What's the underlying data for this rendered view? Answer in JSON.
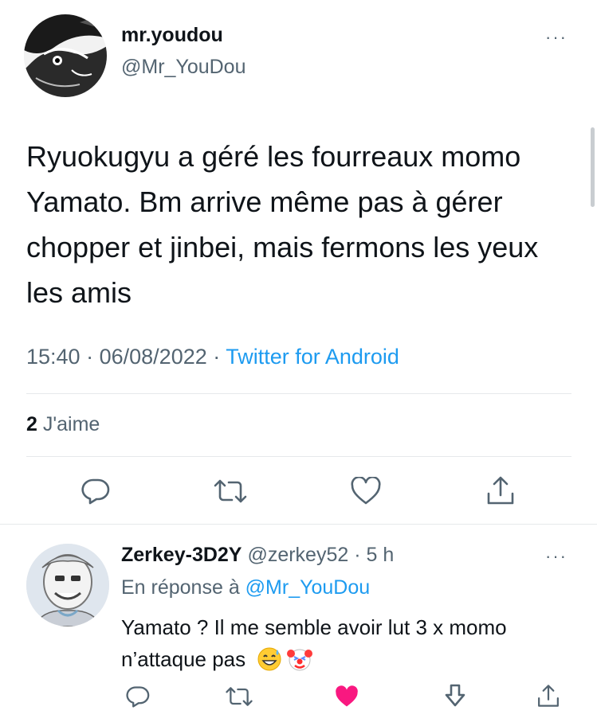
{
  "tweet": {
    "author_name": "mr.youdou",
    "author_handle": "@Mr_YouDou",
    "more_glyph": "···",
    "text": "Ryuokugyu a géré les fourreaux momo Yamato. Bm arrive même pas à gérer chopper et jinbei, mais fermons les yeux les amis",
    "time": "15:40",
    "date": "06/08/2022",
    "sep": "·",
    "source": "Twitter for Android",
    "likes_count": "2",
    "likes_label": "J'aime",
    "icons": [
      "reply-icon",
      "retweet-icon",
      "like-icon",
      "share-icon"
    ]
  },
  "reply": {
    "author_name": "Zerkey-3D2Y",
    "author_handle": "@zerkey52",
    "sep": "·",
    "age": "5 h",
    "more_glyph": "···",
    "in_reply_prefix": "En réponse à",
    "in_reply_handle": "@Mr_YouDou",
    "text_line1": "Yamato ? Il me semble avoir lut 3 x momo",
    "text_line2": "n’attaque pas",
    "emojis": [
      "sweat-smile-emoji",
      "clown-emoji"
    ],
    "liked": true,
    "colors": {
      "like_active": "#f91880"
    }
  }
}
